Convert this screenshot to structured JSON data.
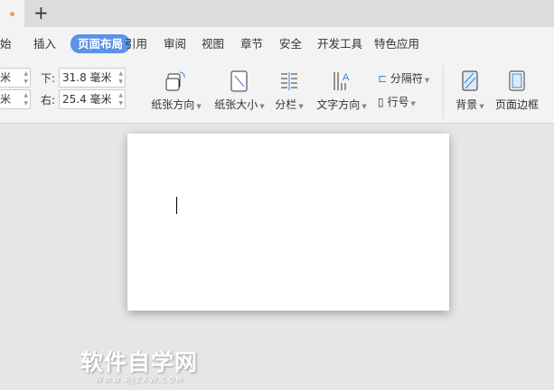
{
  "tabbar": {
    "new_tab": "+"
  },
  "menu": {
    "items": [
      "始",
      "插入",
      "页面布局",
      "引用",
      "审阅",
      "视图",
      "章节",
      "安全",
      "开发工具",
      "特色应用"
    ],
    "active": "页面布局"
  },
  "margins": {
    "top_left_unit": "米",
    "bottom_left_unit": "米",
    "bottom_label": "下:",
    "bottom_value": "31.8 毫米",
    "right_label": "右:",
    "right_value": "25.4 毫米"
  },
  "ribbon": {
    "orientation": "纸张方向",
    "size": "纸张大小",
    "columns": "分栏",
    "text_direction": "文字方向",
    "breaks": "分隔符",
    "line_numbers": "行号",
    "background": "背景",
    "page_border": "页面边框"
  },
  "watermark": {
    "title": "软件自学网",
    "url": "WWW.RJZXW.COM"
  }
}
